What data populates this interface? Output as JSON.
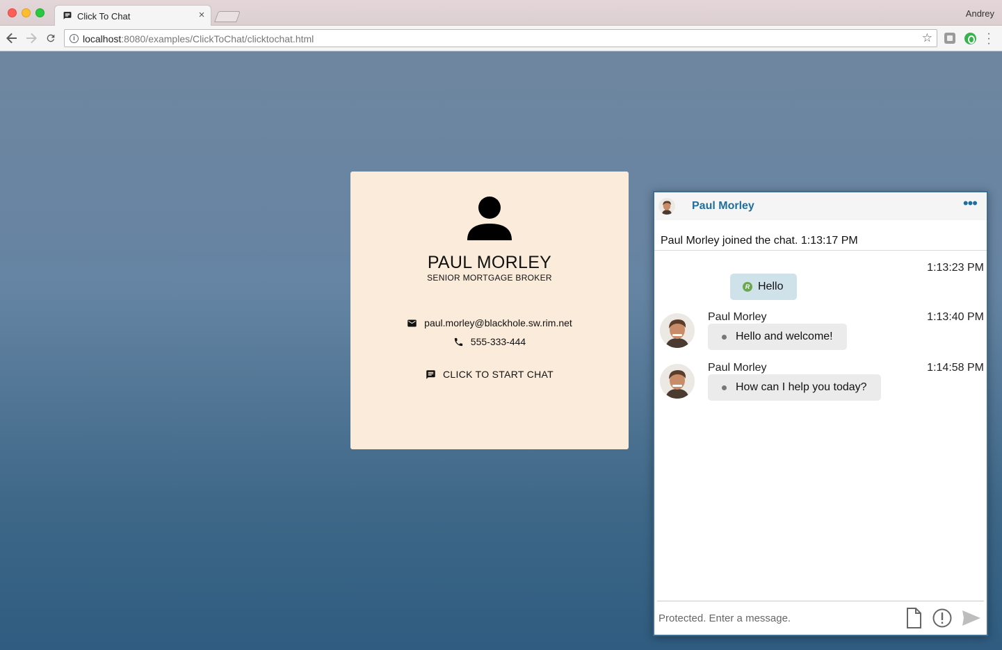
{
  "browser": {
    "tab_title": "Click To Chat",
    "tab_close": "×",
    "profile_name": "Andrey",
    "url_host": "localhost",
    "url_path": ":8080/examples/ClickToChat/clicktochat.html"
  },
  "card": {
    "name": "PAUL MORLEY",
    "title": "SENIOR MORTGAGE BROKER",
    "email": "paul.morley@blackhole.sw.rim.net",
    "phone": "555-333-444",
    "chat_cta": "CLICK TO START CHAT"
  },
  "chat": {
    "header_name": "Paul Morley",
    "more_label": "•••",
    "system_message": "Paul Morley joined the chat. 1:13:17 PM",
    "messages": [
      {
        "direction": "outgoing",
        "time": "1:13:23 PM",
        "text": "Hello",
        "badge": "R"
      },
      {
        "direction": "incoming",
        "sender": "Paul Morley",
        "time": "1:13:40 PM",
        "text": "Hello and welcome!"
      },
      {
        "direction": "incoming",
        "sender": "Paul Morley",
        "time": "1:14:58 PM",
        "text": "How can I help you today?"
      }
    ],
    "composer_placeholder": "Protected. Enter a message."
  },
  "colors": {
    "accent": "#1f6e9c",
    "card_bg": "#fbebdb",
    "outgoing_bubble": "#cfe2ea",
    "incoming_bubble": "#ebebeb"
  },
  "icons": [
    "chat-bubble-icon",
    "info-icon",
    "star-icon",
    "person-icon",
    "email-icon",
    "phone-icon",
    "more-icon",
    "attach-file-icon",
    "urgent-icon",
    "send-icon"
  ]
}
